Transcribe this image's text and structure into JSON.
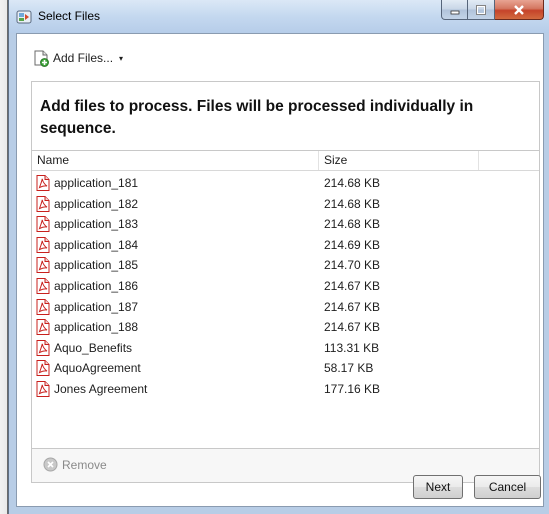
{
  "window": {
    "title": "Select Files"
  },
  "toolbar": {
    "add_files_label": "Add Files...",
    "add_files_caret": "▾"
  },
  "instructions": "Add files to process. Files will be processed individually in sequence.",
  "table": {
    "columns": [
      "Name",
      "Size"
    ],
    "rows": [
      {
        "name": "application_181",
        "size": "214.68 KB"
      },
      {
        "name": "application_182",
        "size": "214.68 KB"
      },
      {
        "name": "application_183",
        "size": "214.68 KB"
      },
      {
        "name": "application_184",
        "size": "214.69 KB"
      },
      {
        "name": "application_185",
        "size": "214.70 KB"
      },
      {
        "name": "application_186",
        "size": "214.67 KB"
      },
      {
        "name": "application_187",
        "size": "214.67 KB"
      },
      {
        "name": "application_188",
        "size": "214.67 KB"
      },
      {
        "name": "Aquo_Benefits",
        "size": "113.31 KB"
      },
      {
        "name": "AquoAgreement",
        "size": "58.17 KB"
      },
      {
        "name": "Jones Agreement",
        "size": "177.16 KB"
      }
    ]
  },
  "remove_label": "Remove",
  "buttons": {
    "next": "Next",
    "cancel": "Cancel"
  },
  "icons": {
    "app": "select-files-app-icon",
    "add": "add-files-icon",
    "file": "pdf-file-icon",
    "remove": "remove-icon"
  },
  "colors": {
    "titlebar": "#c4d8ef",
    "close_button": "#c5432a",
    "pdf_red": "#c8201d"
  }
}
